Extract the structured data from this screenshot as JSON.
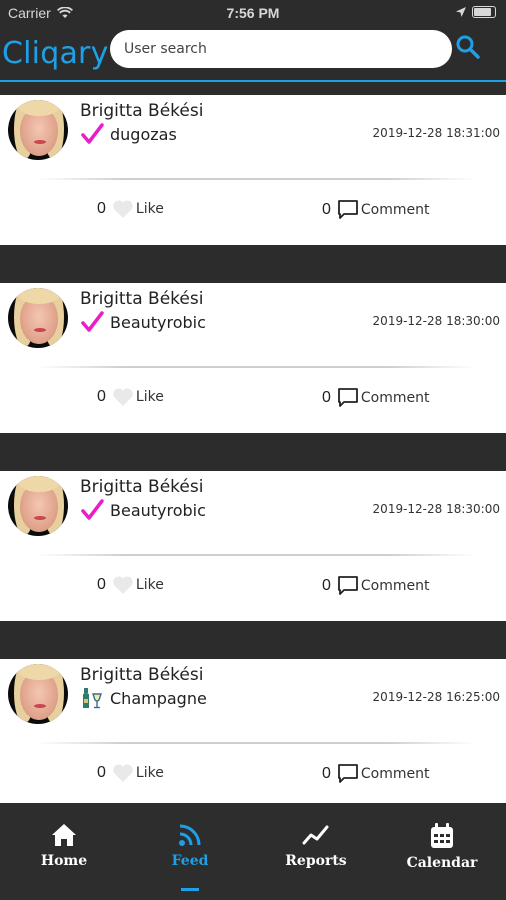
{
  "status_bar": {
    "carrier": "Carrier",
    "time": "7:56 PM"
  },
  "header": {
    "brand": "Cliqary",
    "search_placeholder": "User search"
  },
  "feed": {
    "posts": [
      {
        "author": "Brigitta Békési",
        "activity": "dugozas",
        "activity_icon": "check-icon",
        "timestamp": "2019-12-28 18:31:00",
        "likes": "0",
        "like_label": "Like",
        "comments": "0",
        "comment_label": "Comment"
      },
      {
        "author": "Brigitta Békési",
        "activity": "Beautyrobic",
        "activity_icon": "check-icon",
        "timestamp": "2019-12-28 18:30:00",
        "likes": "0",
        "like_label": "Like",
        "comments": "0",
        "comment_label": "Comment"
      },
      {
        "author": "Brigitta Békési",
        "activity": "Beautyrobic",
        "activity_icon": "check-icon",
        "timestamp": "2019-12-28 18:30:00",
        "likes": "0",
        "like_label": "Like",
        "comments": "0",
        "comment_label": "Comment"
      },
      {
        "author": "Brigitta Békési",
        "activity": "Champagne",
        "activity_icon": "champagne-icon",
        "timestamp": "2019-12-28 16:25:00",
        "likes": "0",
        "like_label": "Like",
        "comments": "0",
        "comment_label": "Comment"
      }
    ]
  },
  "bottom_nav": {
    "items": [
      {
        "label": "Home",
        "icon": "home-icon"
      },
      {
        "label": "Feed",
        "icon": "rss-icon",
        "active": true
      },
      {
        "label": "Reports",
        "icon": "chart-line-icon"
      },
      {
        "label": "Calendar",
        "icon": "calendar-icon"
      }
    ]
  },
  "colors": {
    "accent": "#1ea0e8",
    "check": "#e91ec8",
    "background": "#2c2c2c"
  }
}
